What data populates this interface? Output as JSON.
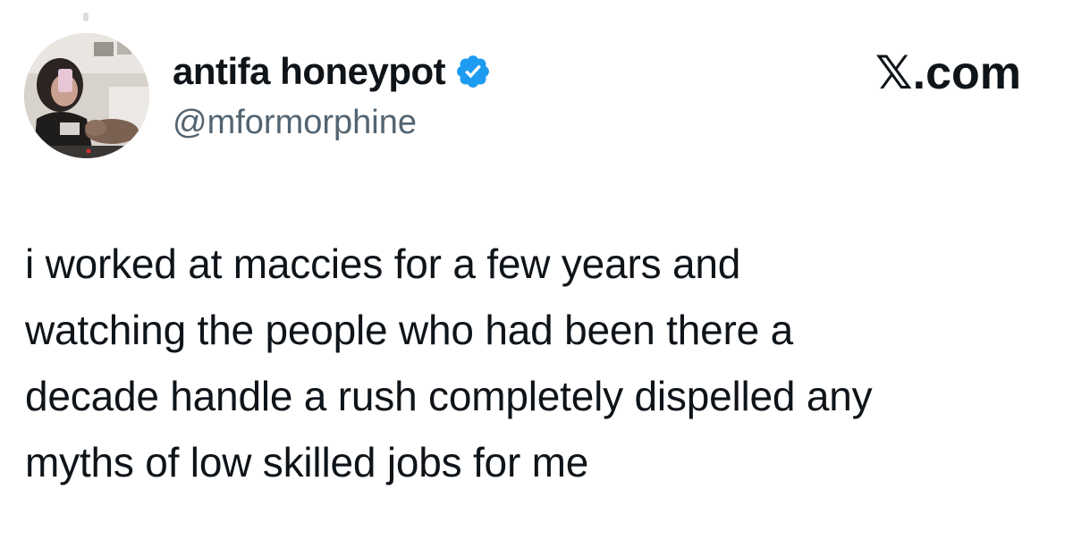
{
  "author": {
    "display_name": "antifa honeypot",
    "handle": "@mformorphine",
    "verified": true,
    "verified_icon": "verified-badge-icon",
    "avatar_icon": "profile-photo"
  },
  "site": {
    "label": ".com",
    "glyph": "𝕏"
  },
  "tweet": {
    "lines": [
      "i worked at maccies for a few years and",
      "watching the people who had been there a",
      "decade handle a rush completely dispelled any",
      "myths of low skilled jobs for me"
    ]
  },
  "colors": {
    "text": "#0f1419",
    "handle": "#536471",
    "verified": "#1d9bf0",
    "background": "#ffffff"
  }
}
